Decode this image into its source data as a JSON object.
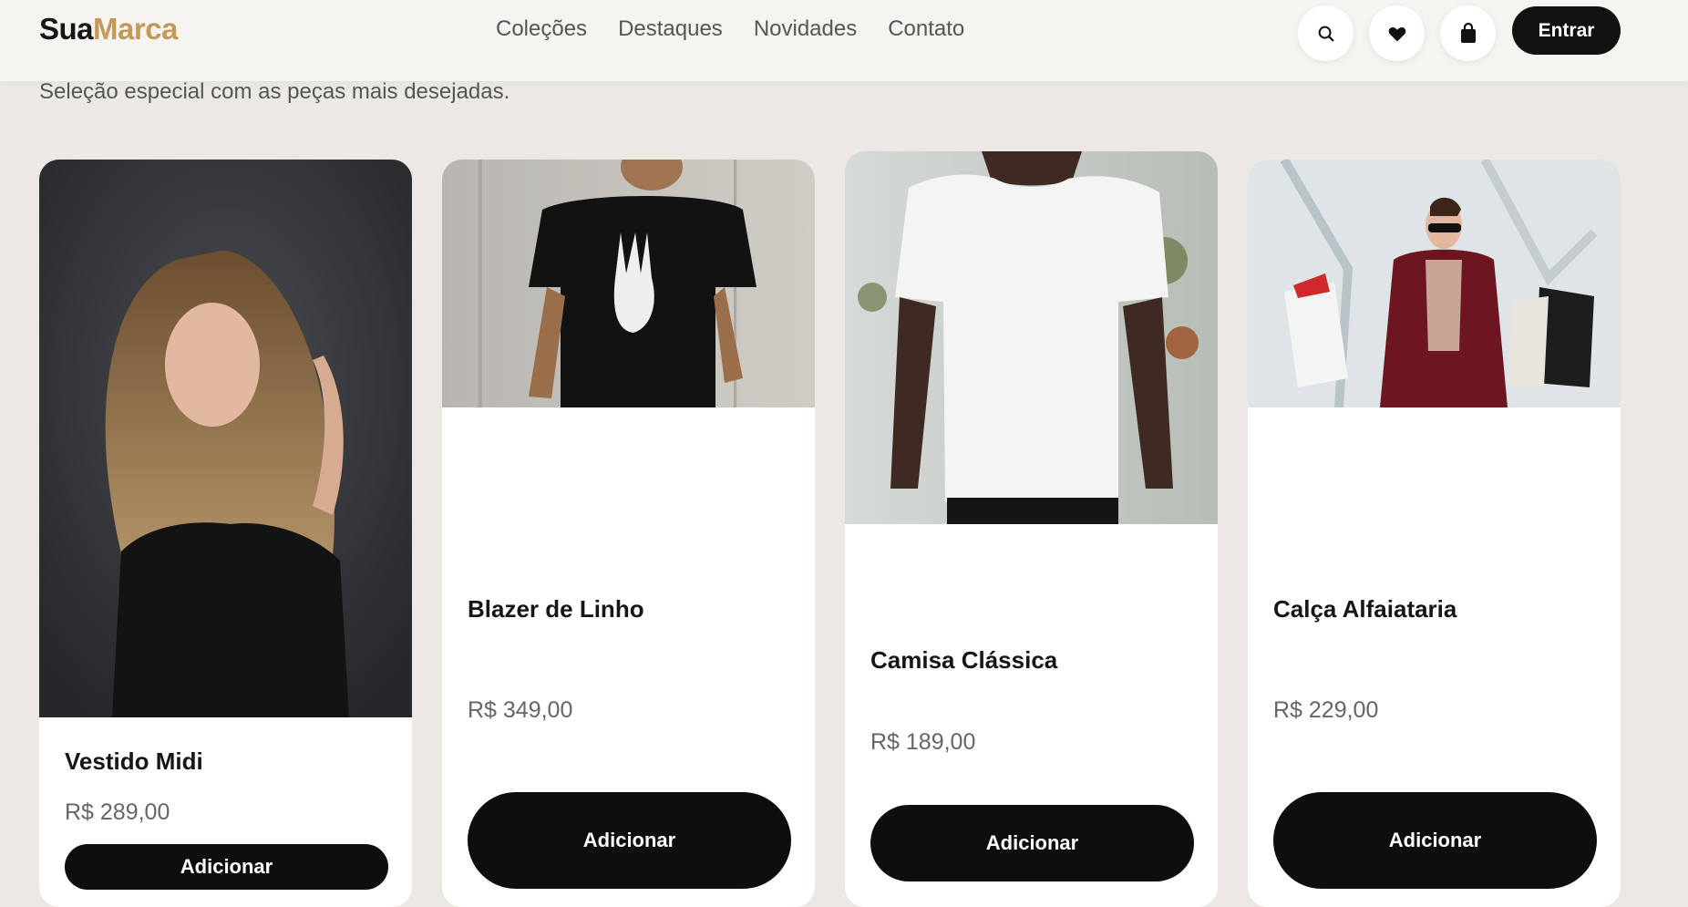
{
  "brand": {
    "part1": "Sua",
    "part2": "Marca"
  },
  "nav": [
    {
      "label": "Coleções"
    },
    {
      "label": "Destaques"
    },
    {
      "label": "Novidades"
    },
    {
      "label": "Contato"
    }
  ],
  "header_icons": [
    "search-icon",
    "heart-icon",
    "bag-icon"
  ],
  "login_label": "Entrar",
  "subtitle": "Seleção especial com as peças mais desejadas.",
  "colors": {
    "accent": "#c49a5a",
    "dark": "#111111",
    "background": "#ece9e4"
  },
  "products": [
    {
      "name": "Vestido Midi",
      "price": "R$ 289,00",
      "button": "Adicionar"
    },
    {
      "name": "Blazer de Linho",
      "price": "R$ 349,00",
      "button": "Adicionar"
    },
    {
      "name": "Camisa Clássica",
      "price": "R$ 189,00",
      "button": "Adicionar"
    },
    {
      "name": "Calça Alfaiataria",
      "price": "R$ 229,00",
      "button": "Adicionar"
    }
  ]
}
